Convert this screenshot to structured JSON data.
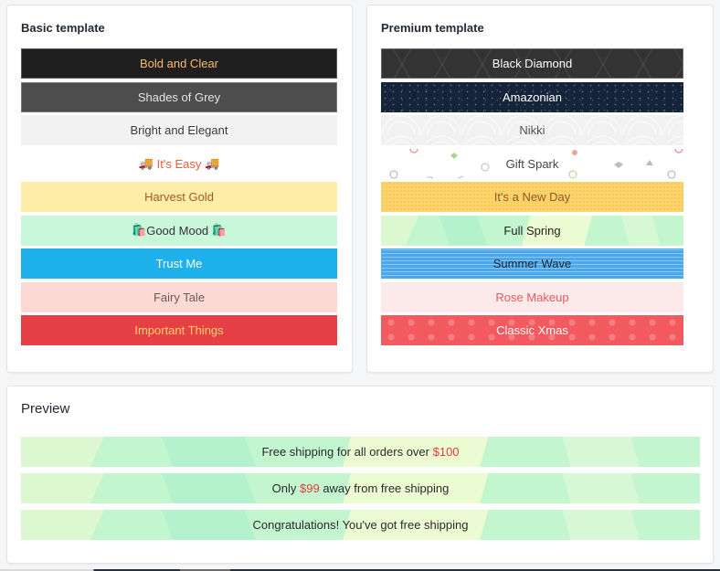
{
  "basic": {
    "title": "Basic template",
    "items": [
      {
        "label": "Bold and Clear"
      },
      {
        "label": "Shades of Grey"
      },
      {
        "label": "Bright and Elegant"
      },
      {
        "label": "It's Easy",
        "prefix": "🚚",
        "suffix": "🚚"
      },
      {
        "label": "Harvest Gold"
      },
      {
        "label": "Good Mood",
        "prefix": "🛍️",
        "suffix": "🛍️"
      },
      {
        "label": "Trust Me"
      },
      {
        "label": "Fairy Tale"
      },
      {
        "label": "Important Things"
      }
    ]
  },
  "premium": {
    "title": "Premium template",
    "items": [
      {
        "label": "Black Diamond"
      },
      {
        "label": "Amazonian"
      },
      {
        "label": "Nikki"
      },
      {
        "label": "Gift Spark"
      },
      {
        "label": "It's a New Day"
      },
      {
        "label": "Full Spring"
      },
      {
        "label": "Summer Wave"
      },
      {
        "label": "Rose Makeup"
      },
      {
        "label": "Classic Xmas"
      }
    ]
  },
  "preview": {
    "title": "Preview",
    "messages": [
      {
        "before": "Free shipping for all orders over ",
        "amount": "$100",
        "after": ""
      },
      {
        "before": "Only ",
        "amount": "$99",
        "after": " away from free shipping"
      },
      {
        "before": "Congratulations! You've got free shipping",
        "amount": "",
        "after": ""
      }
    ]
  },
  "colors": {
    "accent_money": "#e8393f",
    "selected_theme": "Full Spring"
  }
}
